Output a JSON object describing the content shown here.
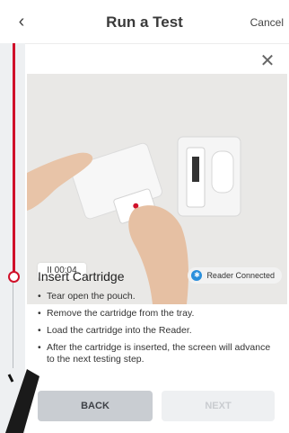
{
  "header": {
    "title": "Run a Test",
    "cancel_label": "Cancel",
    "back_icon": "chevron-left-icon"
  },
  "card": {
    "close_icon": "close-icon",
    "video": {
      "timer": "II 00:04"
    },
    "step_title": "Insert Cartridge",
    "badge": {
      "label": "Reader Connected",
      "icon": "bluetooth-icon",
      "color": "#2a8fdc"
    },
    "instructions": [
      "Tear open the pouch.",
      "Remove the cartridge from the tray.",
      "Load the cartridge into the Reader.",
      "After the cartridge is inserted, the screen will advance to the next testing step."
    ],
    "buttons": {
      "back": "BACK",
      "next": "NEXT"
    }
  },
  "colors": {
    "progress_accent": "#d0102a",
    "back_button": "#c9cdd2",
    "next_button_disabled": "#eef0f2"
  }
}
